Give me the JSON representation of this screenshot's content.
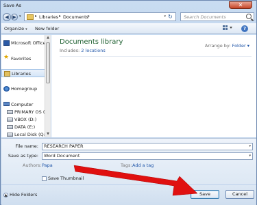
{
  "window": {
    "title": "Save As",
    "close_glyph": "✕"
  },
  "address": {
    "crumbs": [
      "Libraries",
      "Documents"
    ],
    "separator": "▸",
    "search_placeholder": "Search Documents"
  },
  "toolbar": {
    "organize": "Organize",
    "new_folder": "New folder",
    "caret": "▾",
    "help": "?"
  },
  "nav": {
    "items": [
      {
        "label": "Microsoft Office W",
        "icon": "word-icon"
      },
      {
        "label": "Favorites",
        "icon": "star-icon"
      },
      {
        "label": "Libraries",
        "icon": "library-icon"
      },
      {
        "label": "Homegroup",
        "icon": "homegroup-icon"
      },
      {
        "label": "Computer",
        "icon": "computer-icon"
      },
      {
        "label": "PRIMARY OS (C:)",
        "icon": "drive-icon"
      },
      {
        "label": "VBOX (D:)",
        "icon": "drive-icon"
      },
      {
        "label": "DATA (E:)",
        "icon": "drive-icon"
      },
      {
        "label": "Local Disk (Q:)",
        "icon": "drive-icon"
      }
    ]
  },
  "content": {
    "title": "Documents library",
    "includes_label": "Includes:",
    "includes_link": "2 locations",
    "arrange_label": "Arrange by:",
    "arrange_value": "Folder"
  },
  "details": {
    "file_name_label": "File name:",
    "file_name_value": "RESEARCH PAPER",
    "save_type_label": "Save as type:",
    "save_type_value": "Word Document",
    "authors_label": "Authors:",
    "authors_value": "Papa",
    "tags_label": "Tags:",
    "tags_value": "Add a tag",
    "thumbnail_label": "Save Thumbnail"
  },
  "footer": {
    "hide_folders": "Hide Folders",
    "save": "Save",
    "cancel": "Cancel"
  },
  "colors": {
    "arrow": "#e01010",
    "library_title": "#1d5f2f",
    "link": "#1f55a8"
  }
}
